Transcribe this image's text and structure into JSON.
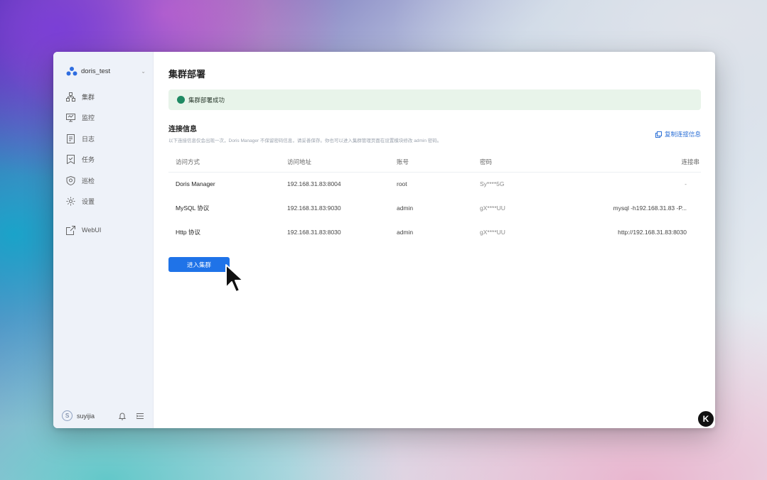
{
  "sidebar": {
    "workspace": "doris_test",
    "items": [
      {
        "label": "集群",
        "icon": "cluster-icon"
      },
      {
        "label": "监控",
        "icon": "monitor-icon"
      },
      {
        "label": "日志",
        "icon": "log-icon"
      },
      {
        "label": "任务",
        "icon": "task-icon"
      },
      {
        "label": "巡检",
        "icon": "inspection-icon"
      },
      {
        "label": "设置",
        "icon": "settings-icon"
      }
    ],
    "webui": "WebUI",
    "user": {
      "initial": "S",
      "name": "suyijia"
    }
  },
  "main": {
    "title": "集群部署",
    "alert": "集群部署成功",
    "section_title": "连接信息",
    "section_note": "以下连接信息仅会出现一次，Doris Manager 不保留密码信息，请妥善保存。你也可以进入集群管理页面在设置模块修改 admin 密码。",
    "copy_label": "复制连接信息",
    "table": {
      "headers": [
        "访问方式",
        "访问地址",
        "账号",
        "密码",
        "连接串"
      ],
      "rows": [
        [
          "Doris Manager",
          "192.168.31.83:8004",
          "root",
          "Sy****5G",
          "-"
        ],
        [
          "MySQL 协议",
          "192.168.31.83:9030",
          "admin",
          "gX****UU",
          "mysql -h192.168.31.83 -P..."
        ],
        [
          "Http 协议",
          "192.168.31.83:8030",
          "admin",
          "gX****UU",
          "http://192.168.31.83:8030"
        ]
      ]
    },
    "enter_button": "进入集群"
  },
  "badge": "K",
  "colors": {
    "accent": "#1f73e8",
    "success": "#1f8a63",
    "alert_bg": "#e8f4ea",
    "sidebar_bg": "#eef2f9"
  }
}
